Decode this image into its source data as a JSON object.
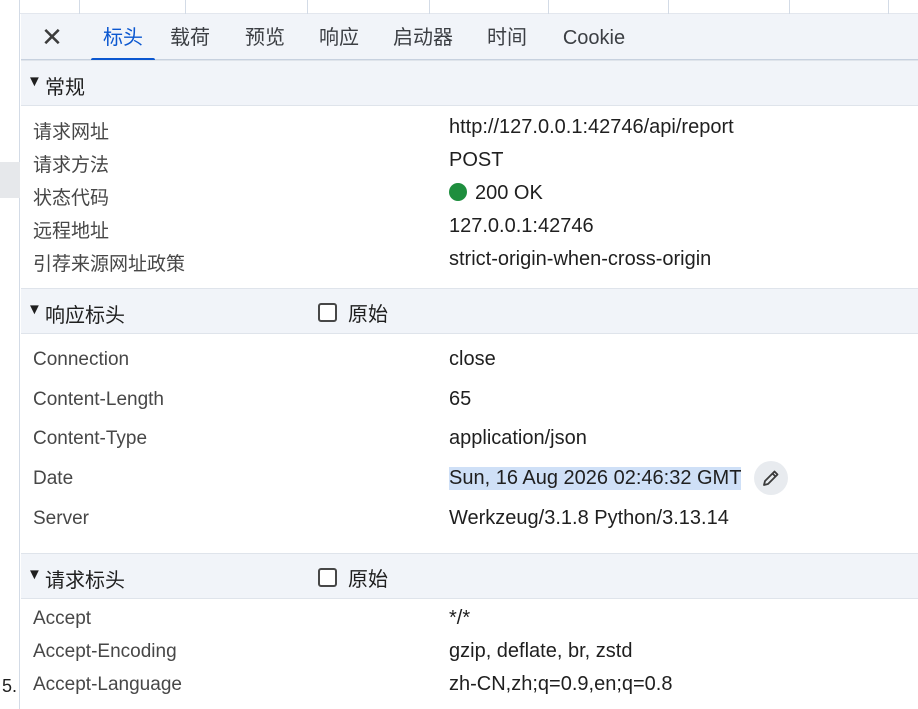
{
  "left_fragment": "5.",
  "tabs": {
    "close_glyph": "✕",
    "items": [
      "标头",
      "载荷",
      "预览",
      "响应",
      "启动器",
      "时间",
      "Cookie"
    ],
    "active": "标头"
  },
  "general": {
    "title": "常规",
    "rows": [
      {
        "key": "请求网址",
        "value": "http://127.0.0.1:42746/api/report"
      },
      {
        "key": "请求方法",
        "value": "POST"
      },
      {
        "key": "状态代码",
        "value": "200 OK",
        "status_color": "#1e8e3e"
      },
      {
        "key": "远程地址",
        "value": "127.0.0.1:42746"
      },
      {
        "key": "引荐来源网址政策",
        "value": "strict-origin-when-cross-origin"
      }
    ]
  },
  "response_headers": {
    "title": "响应标头",
    "raw_label": "原始",
    "raw_checked": false,
    "rows": [
      {
        "key": "Connection",
        "value": "close"
      },
      {
        "key": "Content-Length",
        "value": "65"
      },
      {
        "key": "Content-Type",
        "value": "application/json"
      },
      {
        "key": "Date",
        "value": "Sun, 16 Aug 2026 02:46:32 GMT",
        "selected": true
      },
      {
        "key": "Server",
        "value": "Werkzeug/3.1.8 Python/3.13.14"
      }
    ]
  },
  "request_headers": {
    "title": "请求标头",
    "raw_label": "原始",
    "raw_checked": false,
    "rows": [
      {
        "key": "Accept",
        "value": "*/*"
      },
      {
        "key": "Accept-Encoding",
        "value": "gzip, deflate, br, zstd"
      },
      {
        "key": "Accept-Language",
        "value": "zh-CN,zh;q=0.9,en;q=0.8"
      }
    ]
  },
  "colors": {
    "accent": "#0b57d0",
    "selection": "#cfe0f7",
    "status_ok": "#1e8e3e"
  },
  "icons": {
    "close": "close-icon",
    "edit": "pencil-icon",
    "section_toggle": "triangle-down-icon"
  }
}
